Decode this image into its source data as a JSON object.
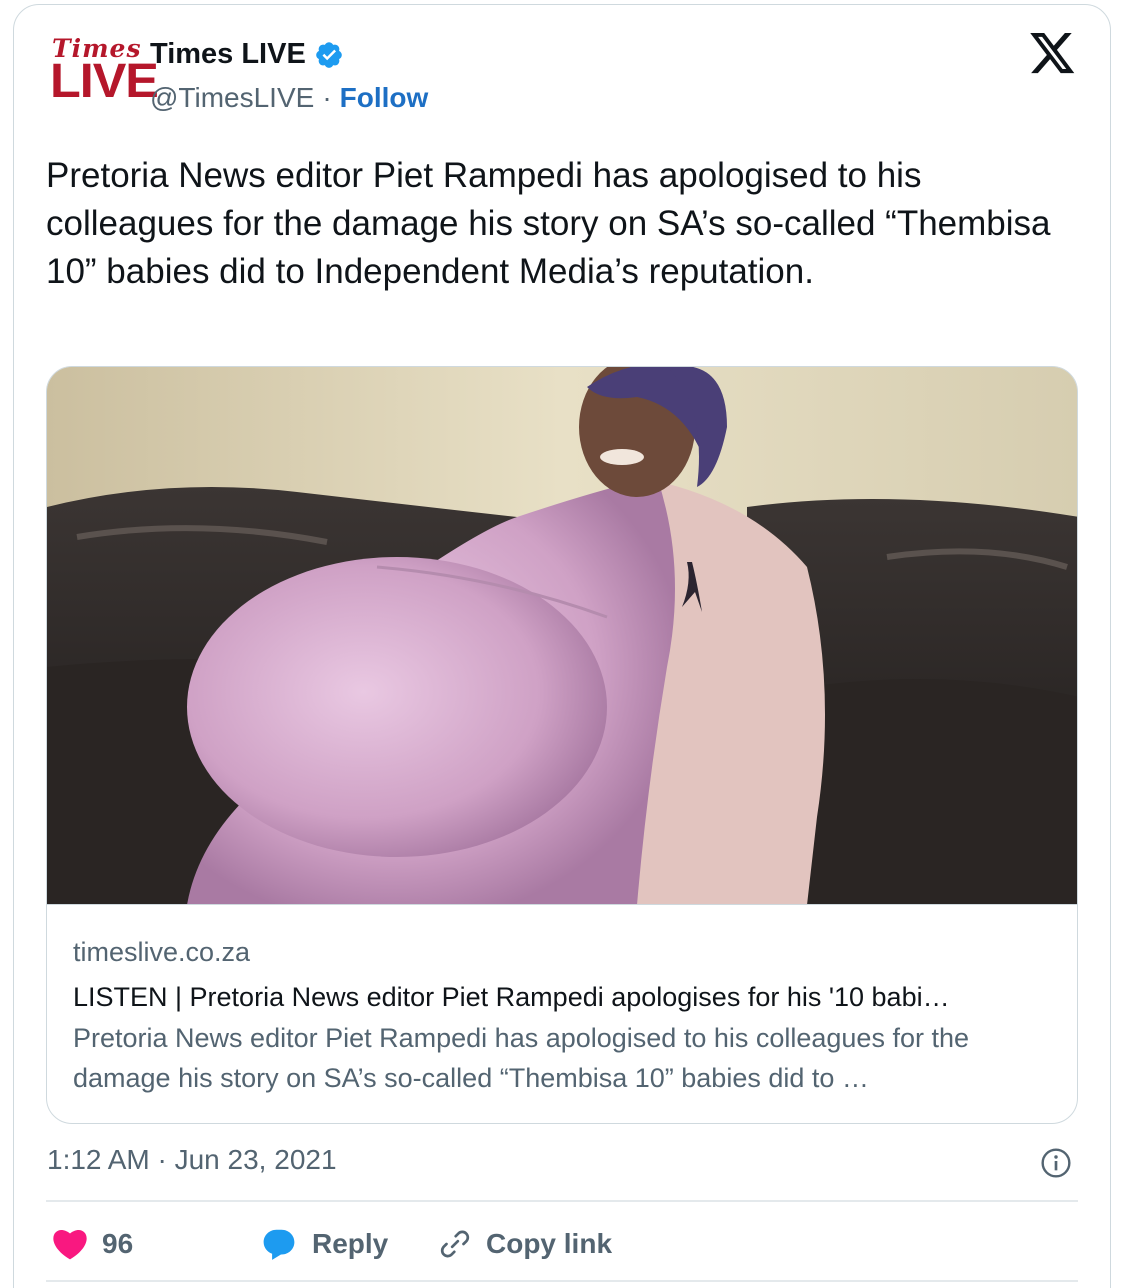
{
  "author": {
    "logo_line1": "Times",
    "logo_line2": "LIVE",
    "name": "Times LIVE",
    "handle": "@TimesLIVE",
    "separator": "·",
    "follow_label": "Follow"
  },
  "tweet": {
    "text": "Pretoria News editor Piet Rampedi has apologised to his colleagues for the damage his story on SA’s so-called “Thembisa 10” babies did to Independent Media’s reputation."
  },
  "link_card": {
    "domain": "timeslive.co.za",
    "title": "LISTEN | Pretoria News editor Piet Rampedi apologises for his '10 babi…",
    "description": "Pretoria News editor Piet Rampedi has apologised to his colleagues for the damage his story on SA’s so-called “Thembisa 10” babies did to …"
  },
  "meta": {
    "timestamp": "1:12 AM · Jun 23, 2021"
  },
  "actions": {
    "like_count": "96",
    "reply_label": "Reply",
    "copy_link_label": "Copy link"
  },
  "colors": {
    "accent": "#1d9bf0",
    "follow": "#1d6fc4",
    "like": "#f91880",
    "logo_red": "#b5172b"
  },
  "icons": [
    "verified-badge-icon",
    "x-logo-icon",
    "info-icon",
    "heart-icon",
    "reply-bubble-icon",
    "link-icon"
  ]
}
